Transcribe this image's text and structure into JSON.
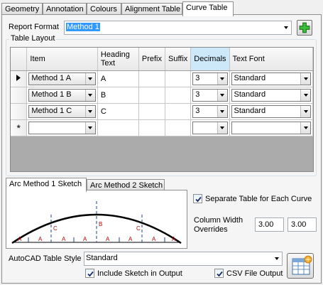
{
  "tabs": [
    "Geometry",
    "Annotation",
    "Colours",
    "Alignment Table",
    "Curve Table"
  ],
  "active_tab": "Curve Table",
  "report_format": {
    "label": "Report Format",
    "value": "Method 1"
  },
  "table_layout": {
    "group_label": "Table Layout",
    "columns": [
      "Item",
      "Heading Text",
      "Prefix",
      "Suffix",
      "Decimals",
      "Text Font"
    ],
    "rows": [
      {
        "item": "Method 1 A",
        "heading": "A",
        "prefix": "",
        "suffix": "",
        "decimals": "3",
        "font": "Standard"
      },
      {
        "item": "Method 1 B",
        "heading": "B",
        "prefix": "",
        "suffix": "",
        "decimals": "3",
        "font": "Standard"
      },
      {
        "item": "Method 1 C",
        "heading": "C",
        "prefix": "",
        "suffix": "",
        "decimals": "3",
        "font": "Standard"
      },
      {
        "item": "",
        "heading": "",
        "prefix": "",
        "suffix": "",
        "decimals": "",
        "font": ""
      }
    ],
    "new_row_marker": "*"
  },
  "sketch_tabs": [
    "Arc Method 1 Sketch",
    "Arc Method 2 Sketch"
  ],
  "active_sketch_tab": "Arc Method 1 Sketch",
  "sketch_labels": {
    "a": "A",
    "b": "B",
    "c": "C"
  },
  "separate_table": {
    "label": "Separate Table for Each Curve",
    "checked": true
  },
  "column_width": {
    "label_line1": "Column Width",
    "label_line2": "Overrides",
    "value1": "3.00",
    "value2": "3.00"
  },
  "autocad_style": {
    "label": "AutoCAD Table Style",
    "value": "Standard"
  },
  "include_sketch": {
    "label": "Include Sketch in Output",
    "checked": true
  },
  "csv_output": {
    "label": "CSV File Output",
    "checked": true
  },
  "colors": {
    "selection": "#3399ff",
    "highlight_header": "#cde8f9",
    "grid_bg": "#ababab",
    "sketch_red": "#c00000",
    "sketch_blue": "#1f3c88"
  }
}
